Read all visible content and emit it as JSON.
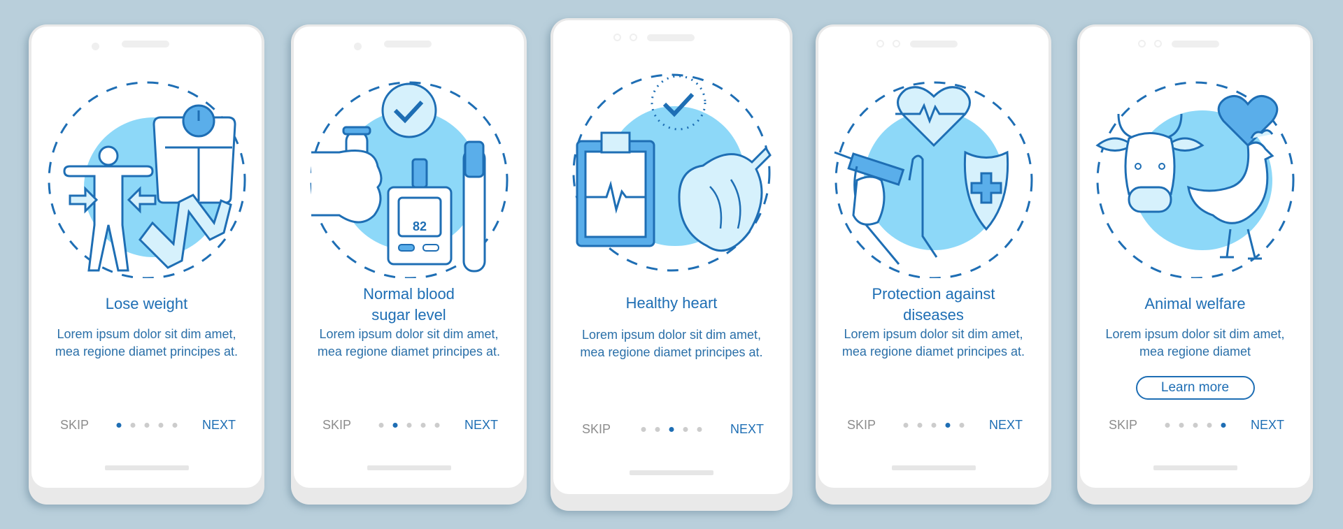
{
  "colors": {
    "background": "#b9cfdb",
    "accent": "#1e6eb4",
    "circle_fill": "#8dd8f8",
    "icon_fill_light": "#d6f1fc",
    "icon_fill_mid": "#5aaeea",
    "dot_inactive": "#cccccc",
    "skip_text": "#8c8c8c"
  },
  "screens": [
    {
      "title": "Lose weight",
      "body": "Lorem ipsum dolor sit dim amet, mea regione diamet principes at.",
      "illustration": "weight-loss-illustration",
      "skip_label": "SKIP",
      "next_label": "NEXT",
      "page_index": 1,
      "page_count": 5
    },
    {
      "title": "Normal blood sugar level",
      "body": "Lorem ipsum dolor sit dim amet, mea regione diamet principes at.",
      "illustration": "blood-sugar-illustration",
      "glucometer_reading": "82",
      "skip_label": "SKIP",
      "next_label": "NEXT",
      "page_index": 2,
      "page_count": 5
    },
    {
      "title": "Healthy heart",
      "body": "Lorem ipsum dolor sit dim amet, mea regione diamet principes at.",
      "illustration": "healthy-heart-illustration",
      "skip_label": "SKIP",
      "next_label": "NEXT",
      "page_index": 3,
      "page_count": 5
    },
    {
      "title": "Protection against diseases",
      "body": "Lorem ipsum dolor sit dim amet, mea regione diamet principes at.",
      "illustration": "disease-protection-illustration",
      "skip_label": "SKIP",
      "next_label": "NEXT",
      "page_index": 4,
      "page_count": 5
    },
    {
      "title": "Animal welfare",
      "body": "Lorem ipsum dolor sit dim amet, mea regione diamet",
      "illustration": "animal-welfare-illustration",
      "button_label": "Learn more",
      "skip_label": "SKIP",
      "next_label": "NEXT",
      "page_index": 5,
      "page_count": 5
    }
  ]
}
